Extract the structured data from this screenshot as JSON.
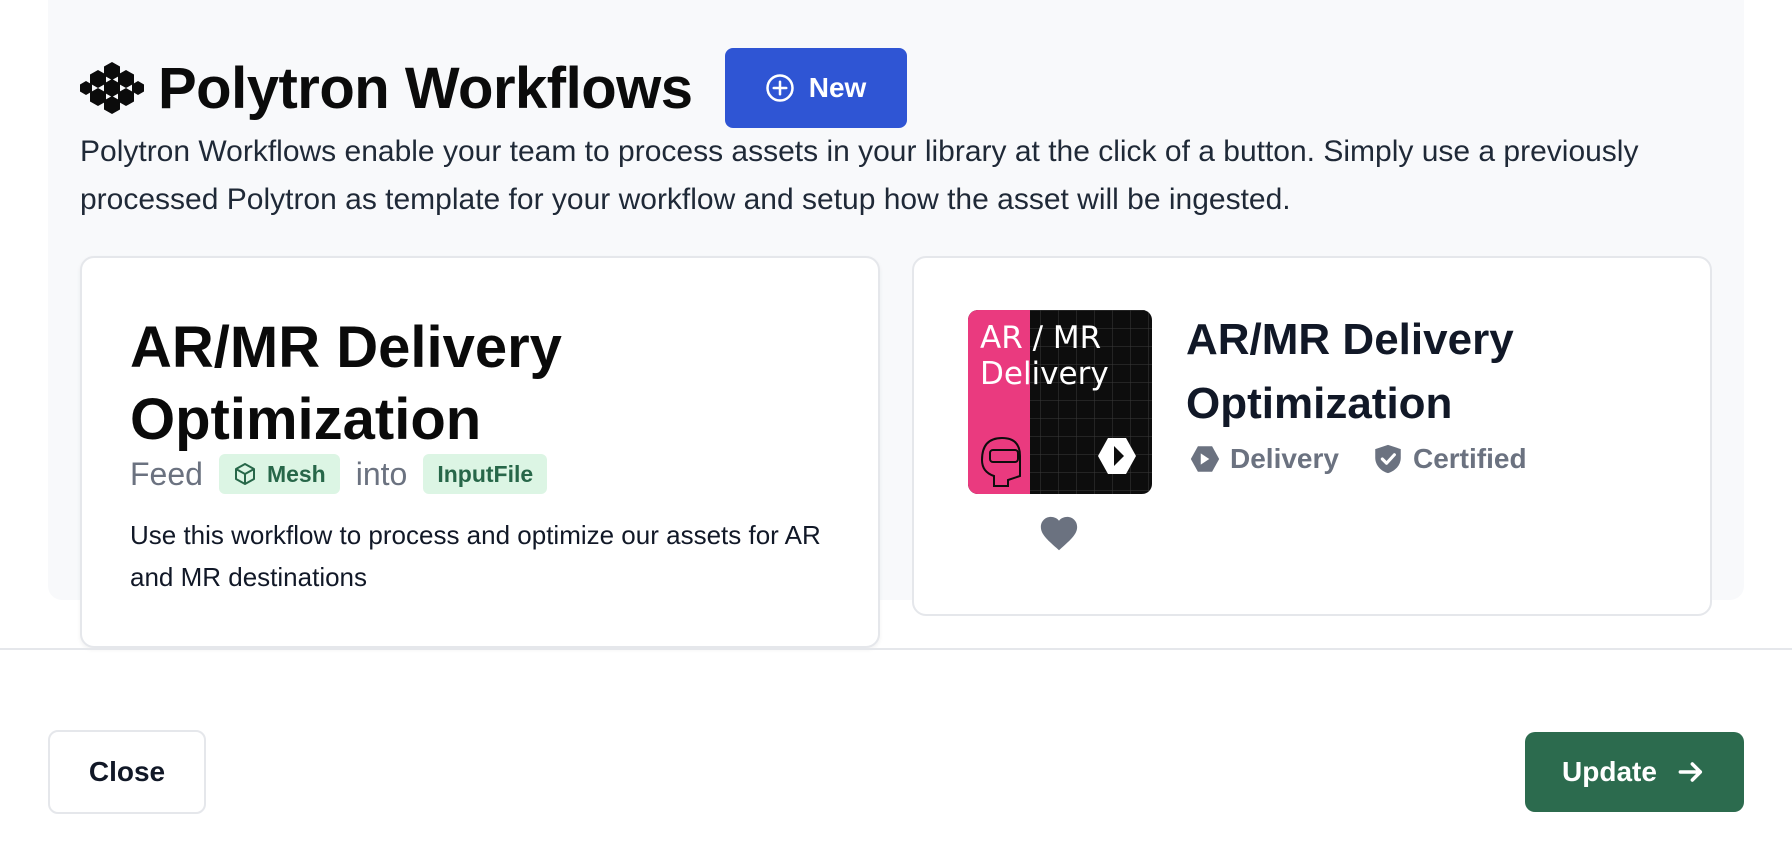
{
  "header": {
    "title": "Polytron Workflows",
    "new_button_label": "New",
    "logo_icon": "hexagon-cluster-icon"
  },
  "description": "Polytron Workflows enable your team to process assets in your library at the click of a button. Simply use a previously processed Polytron as template for your workflow and setup how the asset will be ingested.",
  "workflow_card": {
    "title": "AR/MR Delivery Optimization",
    "feed_label": "Feed",
    "input_tag": "Mesh",
    "into_label": "into",
    "output_tag": "InputFile",
    "description": "Use this workflow to process and optimize our assets for AR and MR destinations"
  },
  "template_card": {
    "title": "AR/MR Delivery Optimization",
    "thumbnail_text_line1": "AR / MR",
    "thumbnail_text_line2": "Delivery",
    "category": "Delivery",
    "badge": "Certified",
    "colors": {
      "thumb_pink": "#ea3a7f",
      "thumb_dark": "#0d0d0d"
    }
  },
  "footer": {
    "close_label": "Close",
    "update_label": "Update"
  },
  "colors": {
    "primary": "#2f55d4",
    "success": "#2c6b4e",
    "tag_bg": "#dcf5e4",
    "tag_text": "#276749"
  }
}
